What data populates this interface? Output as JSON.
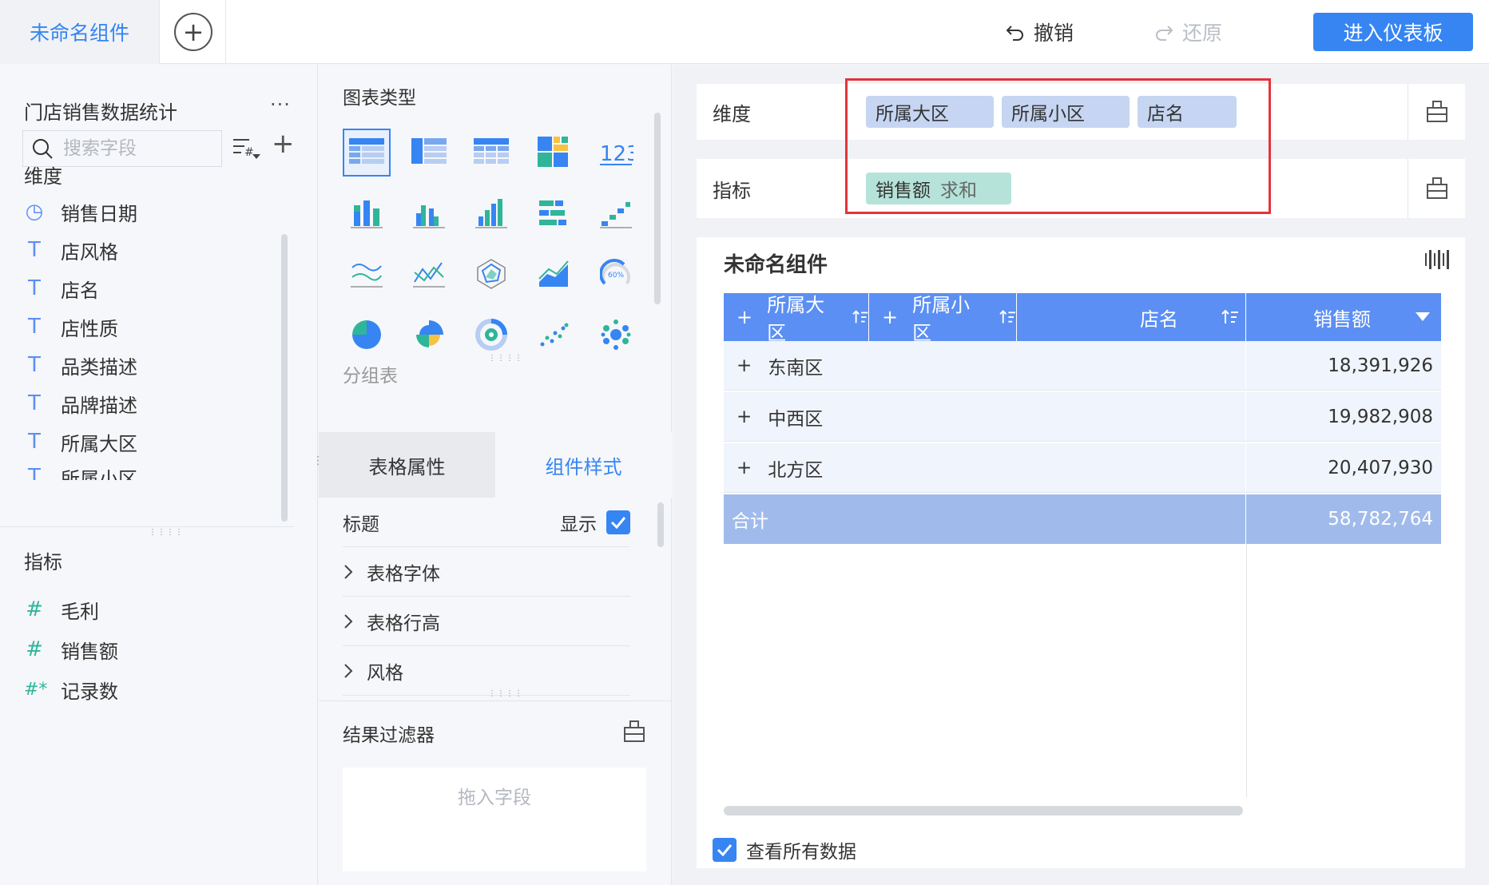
{
  "header": {
    "tab_label": "未命名组件",
    "add_tab_glyph": "+",
    "undo_label": "撤销",
    "redo_label": "还原",
    "enter_dashboard_label": "进入仪表板"
  },
  "left": {
    "dataset_title": "门店销售数据统计",
    "more_glyph": "···",
    "search_placeholder": "搜索字段",
    "plus_glyph": "+",
    "dimensions_label": "维度",
    "dimensions": [
      {
        "icon": "clock-icon",
        "glyph": "◷",
        "label": "销售日期"
      },
      {
        "icon": "text-type-icon",
        "glyph": "T",
        "label": "店风格"
      },
      {
        "icon": "text-type-icon",
        "glyph": "T",
        "label": "店名"
      },
      {
        "icon": "text-type-icon",
        "glyph": "T",
        "label": "店性质"
      },
      {
        "icon": "text-type-icon",
        "glyph": "T",
        "label": "品类描述"
      },
      {
        "icon": "text-type-icon",
        "glyph": "T",
        "label": "品牌描述"
      },
      {
        "icon": "text-type-icon",
        "glyph": "T",
        "label": "所属大区"
      },
      {
        "icon": "text-type-icon",
        "glyph": "T",
        "label": "所属小区"
      }
    ],
    "measures_label": "指标",
    "measures": [
      {
        "icon": "number-type-icon",
        "glyph": "#",
        "label": "毛利"
      },
      {
        "icon": "number-type-icon",
        "glyph": "#",
        "label": "销售额"
      },
      {
        "icon": "record-count-icon",
        "glyph": "#*",
        "label": "记录数"
      }
    ]
  },
  "middle": {
    "chart_type_label": "图表类型",
    "selected_chart_name": "分组表",
    "tabs": [
      "表格属性",
      "组件样式"
    ],
    "title_row_label": "标题",
    "show_label": "显示",
    "props": [
      "表格字体",
      "表格行高",
      "风格"
    ],
    "filter_label": "结果过滤器",
    "drop_hint": "拖入字段"
  },
  "right": {
    "dimension_row_label": "维度",
    "dimension_pills": [
      "所属大区",
      "所属小区",
      "店名"
    ],
    "measure_row_label": "指标",
    "measure_pill": {
      "name": "销售额",
      "agg": "求和"
    },
    "widget_title": "未命名组件",
    "table": {
      "headers": [
        "所属大区",
        "所属小区",
        "店名",
        "销售额"
      ],
      "rows": [
        {
          "name": "东南区",
          "value": "18,391,926"
        },
        {
          "name": "中西区",
          "value": "19,982,908"
        },
        {
          "name": "北方区",
          "value": "20,407,930"
        }
      ],
      "total_label": "合计",
      "total_value": "58,782,764"
    },
    "view_all_label": "查看所有数据"
  },
  "colors": {
    "accent": "#3685f2",
    "header_blue": "#5b8ff3",
    "highlight_red": "#e5333b",
    "dimension_pill": "#c5d5f2",
    "measure_pill": "#b5e3d9"
  }
}
